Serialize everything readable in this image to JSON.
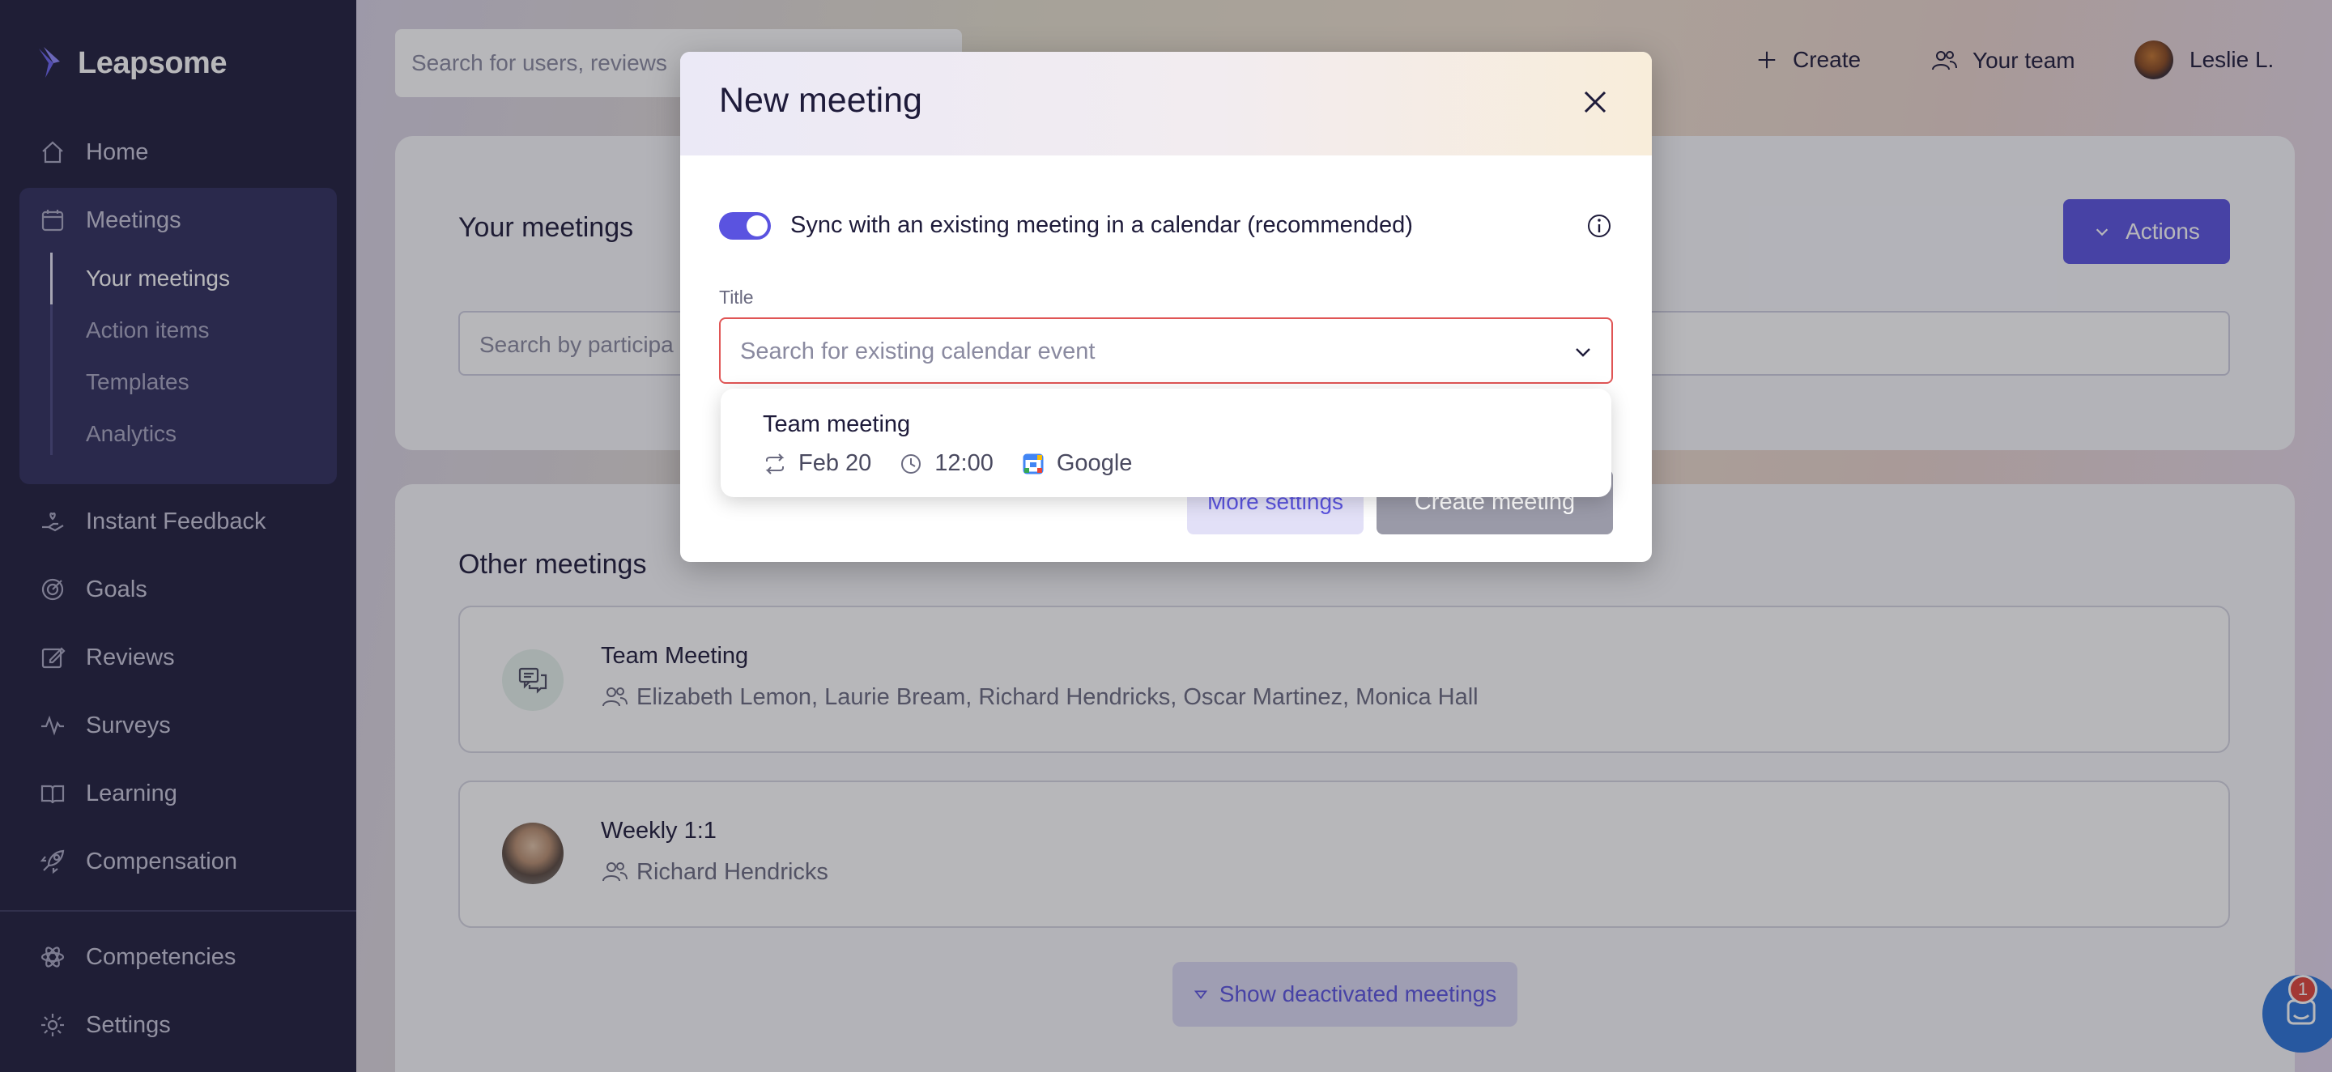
{
  "brand": {
    "name": "Leapsome"
  },
  "sidebar": {
    "items": [
      {
        "label": "Home",
        "icon": "home-icon"
      },
      {
        "label": "Meetings",
        "icon": "calendar-icon"
      },
      {
        "label": "Instant Feedback",
        "icon": "hand-heart-icon"
      },
      {
        "label": "Goals",
        "icon": "target-icon"
      },
      {
        "label": "Reviews",
        "icon": "edit-icon"
      },
      {
        "label": "Surveys",
        "icon": "pulse-icon"
      },
      {
        "label": "Learning",
        "icon": "book-icon"
      },
      {
        "label": "Compensation",
        "icon": "rocket-icon"
      },
      {
        "label": "Competencies",
        "icon": "atom-icon"
      },
      {
        "label": "Settings",
        "icon": "gear-icon"
      }
    ],
    "meetings_sub": [
      {
        "label": "Your meetings"
      },
      {
        "label": "Action items"
      },
      {
        "label": "Templates"
      },
      {
        "label": "Analytics"
      }
    ]
  },
  "header": {
    "search_placeholder": "Search for users, reviews",
    "create_label": "Create",
    "team_label": "Your team",
    "user_name": "Leslie L."
  },
  "your_meetings": {
    "title": "Your meetings",
    "actions_label": "Actions",
    "search_placeholder": "Search by participa"
  },
  "other_meetings": {
    "title": "Other meetings",
    "rows": [
      {
        "name": "Team Meeting",
        "participants": "Elizabeth Lemon, Laurie Bream, Richard Hendricks, Oscar Martinez, Monica Hall"
      },
      {
        "name": "Weekly 1:1",
        "participants": "Richard Hendricks"
      }
    ],
    "show_deactivated_label": "Show deactivated meetings"
  },
  "chat": {
    "badge_count": "1"
  },
  "modal": {
    "title": "New meeting",
    "sync_label": "Sync with an existing meeting in a calendar (recommended)",
    "sync_enabled": true,
    "field_label": "Title",
    "input_placeholder": "Search for existing calendar event",
    "more_settings_label": "More settings",
    "create_label": "Create meeting",
    "dropdown": {
      "event_name": "Team meeting",
      "date": "Feb 20",
      "time": "12:00",
      "calendar": "Google"
    }
  },
  "colors": {
    "accent": "#5a53e0",
    "sidebar_bg": "#1f1e3d",
    "error_border": "#e05555"
  }
}
